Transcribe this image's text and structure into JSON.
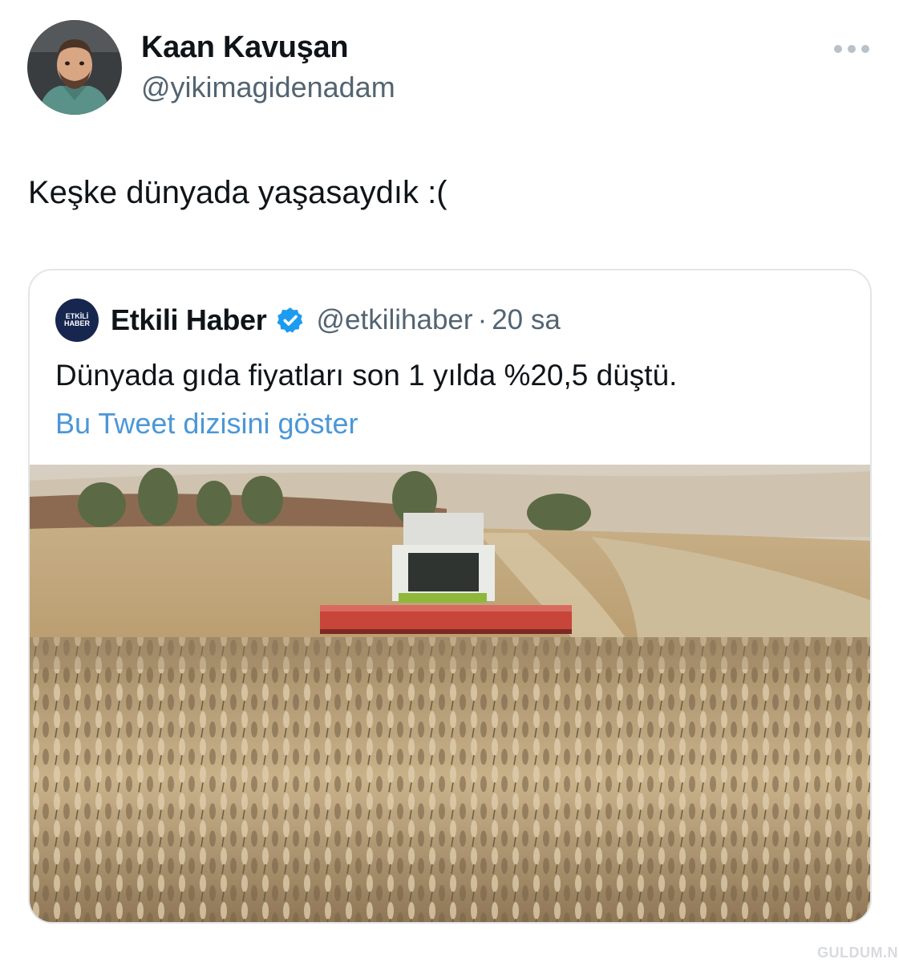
{
  "author": {
    "display_name": "Kaan Kavuşan",
    "handle": "@yikimagidenadam",
    "avatar_icon": "profile-photo"
  },
  "more_icon": "more-options-icon",
  "tweet": {
    "text": "Keşke dünyada yaşasaydık :("
  },
  "quoted": {
    "logo_text_line1": "ETKİLİ",
    "logo_text_line2": "HABER",
    "name": "Etkili Haber",
    "verified_icon": "verified-badge-icon",
    "handle": "@etkilihaber",
    "separator": "·",
    "time": "20 sa",
    "text": "Dünyada gıda fiyatları son 1 yılda %20,5 düştü.",
    "thread_link": "Bu Tweet dizisini göster",
    "link_color": "#4b97d8",
    "image_subject": "combine harvester in a wheat field"
  },
  "watermark": "GULDUM.NET"
}
